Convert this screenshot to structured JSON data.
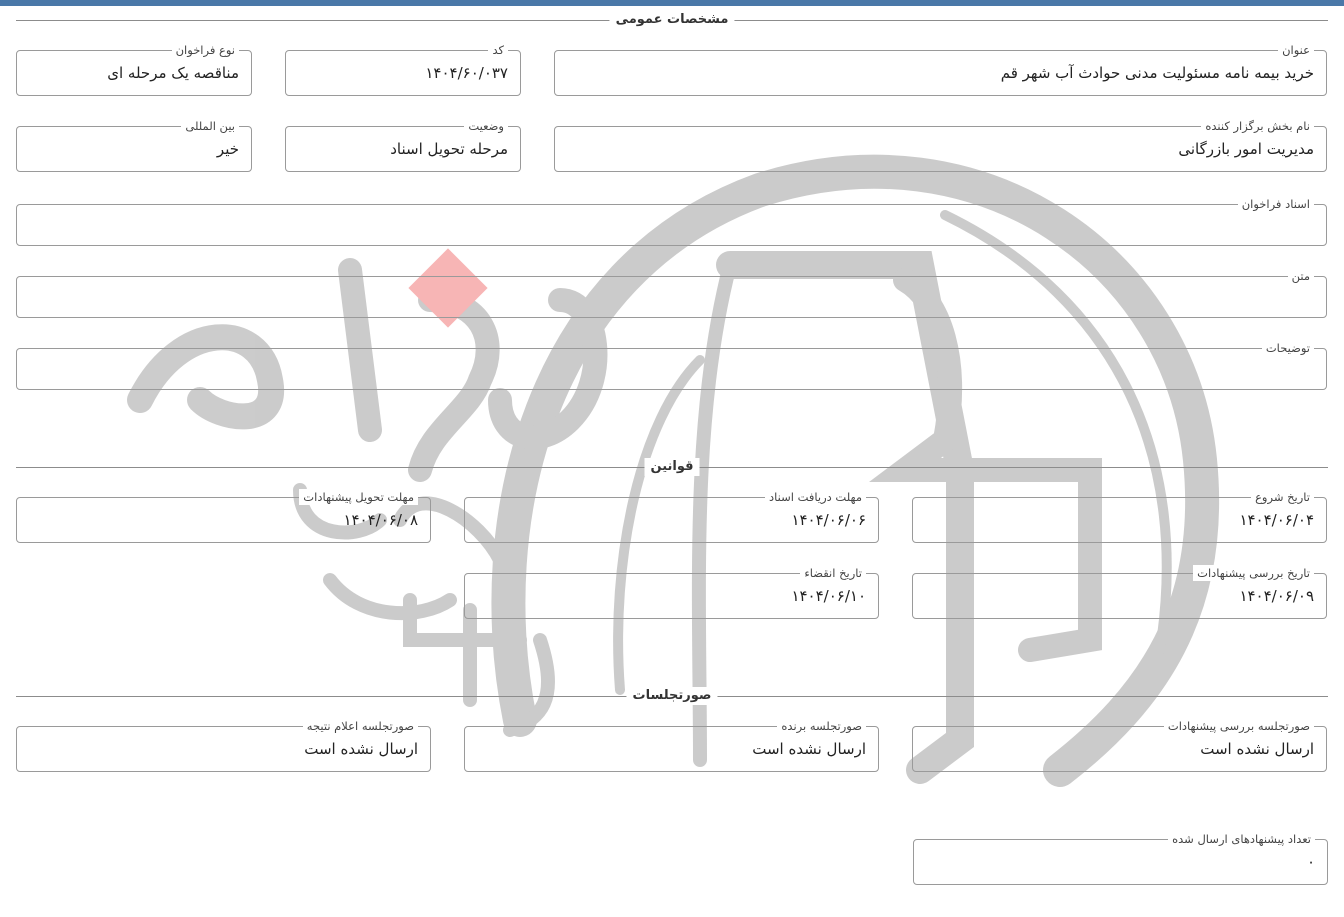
{
  "colors": {
    "top_bar": "#4a78a8",
    "watermark_gray": "#c9c9c9",
    "watermark_red": "#f7b5b5"
  },
  "sections": {
    "general": "مشخصات عمومی",
    "rules": "قوانین",
    "minutes": "صورتجلسات"
  },
  "general": {
    "title": {
      "label": "عنوان",
      "value": "خرید بیمه نامه مسئولیت مدنی حوادث آب شهر قم"
    },
    "code": {
      "label": "کد",
      "value": "۱۴۰۴/۶۰/۰۳۷"
    },
    "call_type": {
      "label": "نوع فراخوان",
      "value": "مناقصه یک مرحله ای"
    },
    "organizer": {
      "label": "نام بخش برگزار کننده",
      "value": "مدیریت امور بازرگانی"
    },
    "status": {
      "label": "وضعیت",
      "value": "مرحله تحویل اسناد"
    },
    "international": {
      "label": "بین المللی",
      "value": "خیر"
    },
    "documents": {
      "label": "اسناد فراخوان",
      "value": ""
    },
    "text": {
      "label": "متن",
      "value": ""
    },
    "description": {
      "label": "توضیحات",
      "value": ""
    }
  },
  "rules": {
    "start_date": {
      "label": "تاریخ شروع",
      "value": "۱۴۰۴/۰۶/۰۴"
    },
    "doc_receive_deadline": {
      "label": "مهلت دریافت اسناد",
      "value": "۱۴۰۴/۰۶/۰۶"
    },
    "offer_delivery_deadline": {
      "label": "مهلت تحویل پیشنهادات",
      "value": "۱۴۰۴/۰۶/۰۸"
    },
    "offer_review_date": {
      "label": "تاریخ بررسی پیشنهادات",
      "value": "۱۴۰۴/۰۶/۰۹"
    },
    "expiry_date": {
      "label": "تاریخ انقضاء",
      "value": "۱۴۰۴/۰۶/۱۰"
    }
  },
  "minutes": {
    "offer_review": {
      "label": "صورتجلسه بررسی پیشنهادات",
      "value": "ارسال نشده است"
    },
    "winner": {
      "label": "صورتجلسه برنده",
      "value": "ارسال نشده است"
    },
    "result": {
      "label": "صورتجلسه اعلام نتیجه",
      "value": "ارسال نشده است"
    }
  },
  "offers_count": {
    "label": "تعداد پیشنهادهای ارسال شده",
    "value": "۰"
  }
}
